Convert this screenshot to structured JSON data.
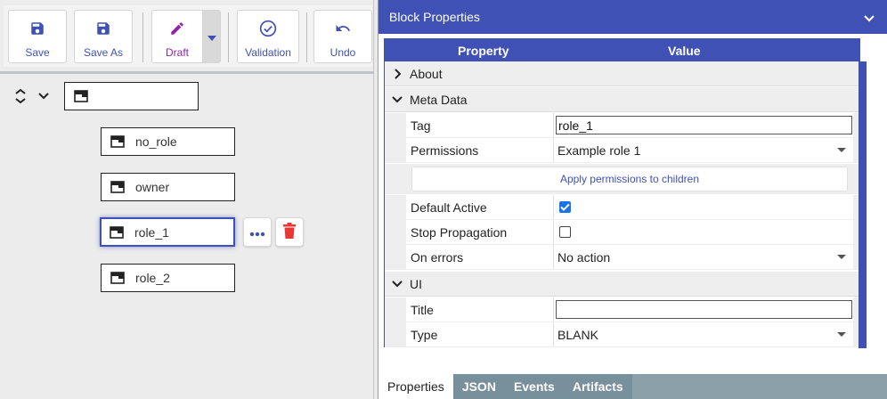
{
  "toolbar": {
    "save": "Save",
    "save_as": "Save As",
    "draft": "Draft",
    "validation": "Validation",
    "undo": "Undo"
  },
  "tree": {
    "root_label": "",
    "nodes": [
      {
        "label": "no_role"
      },
      {
        "label": "owner"
      },
      {
        "label": "role_1",
        "selected": true
      },
      {
        "label": "role_2"
      }
    ]
  },
  "panel": {
    "title": "Block Properties",
    "col_property": "Property",
    "col_value": "Value",
    "sections": {
      "about": "About",
      "meta_data": "Meta Data",
      "ui": "UI"
    },
    "rows": {
      "tag": {
        "label": "Tag",
        "value": "role_1"
      },
      "permissions": {
        "label": "Permissions",
        "value": "Example role 1"
      },
      "apply_button": "Apply permissions to children",
      "default_active": {
        "label": "Default Active",
        "checked": true
      },
      "stop_propagation": {
        "label": "Stop Propagation",
        "checked": false
      },
      "on_errors": {
        "label": "On errors",
        "value": "No action"
      },
      "title": {
        "label": "Title",
        "value": ""
      },
      "type": {
        "label": "Type",
        "value": "BLANK"
      }
    },
    "tabs": [
      "Properties",
      "JSON",
      "Events",
      "Artifacts"
    ]
  },
  "colors": {
    "accent": "#3f51b5",
    "delete": "#e53935",
    "draft": "#8e24aa",
    "tab_bar": "#8ca0aa"
  }
}
